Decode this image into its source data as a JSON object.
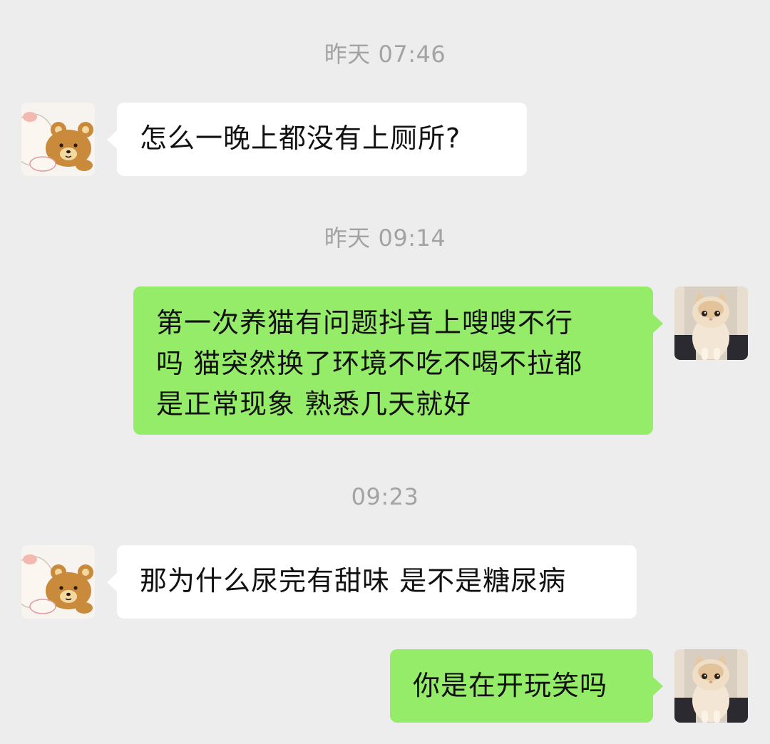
{
  "chat": {
    "messages": [
      {
        "timestamp": "昨天 07:46",
        "sender": "other",
        "lines": [
          "怎么一晚上都没有上厕所?"
        ]
      },
      {
        "timestamp": "昨天 09:14",
        "sender": "self",
        "lines": [
          "第一次养猫有问题抖音上嗖嗖不行",
          "吗 猫突然换了环境不吃不喝不拉都",
          "是正常现象 熟悉几天就好"
        ]
      },
      {
        "timestamp": "09:23",
        "sender": "other",
        "lines": [
          "那为什么尿完有甜味 是不是糖尿病"
        ]
      },
      {
        "timestamp": "",
        "sender": "self",
        "lines": [
          "你是在开玩笑吗"
        ]
      }
    ]
  },
  "avatars": {
    "other": "rilakkuma-bear-avatar",
    "self": "persian-cat-avatar"
  },
  "colors": {
    "background": "#ededed",
    "self_bubble": "#95ec69",
    "other_bubble": "#ffffff",
    "timestamp_text": "#a3a3a3",
    "message_text": "#111111"
  }
}
